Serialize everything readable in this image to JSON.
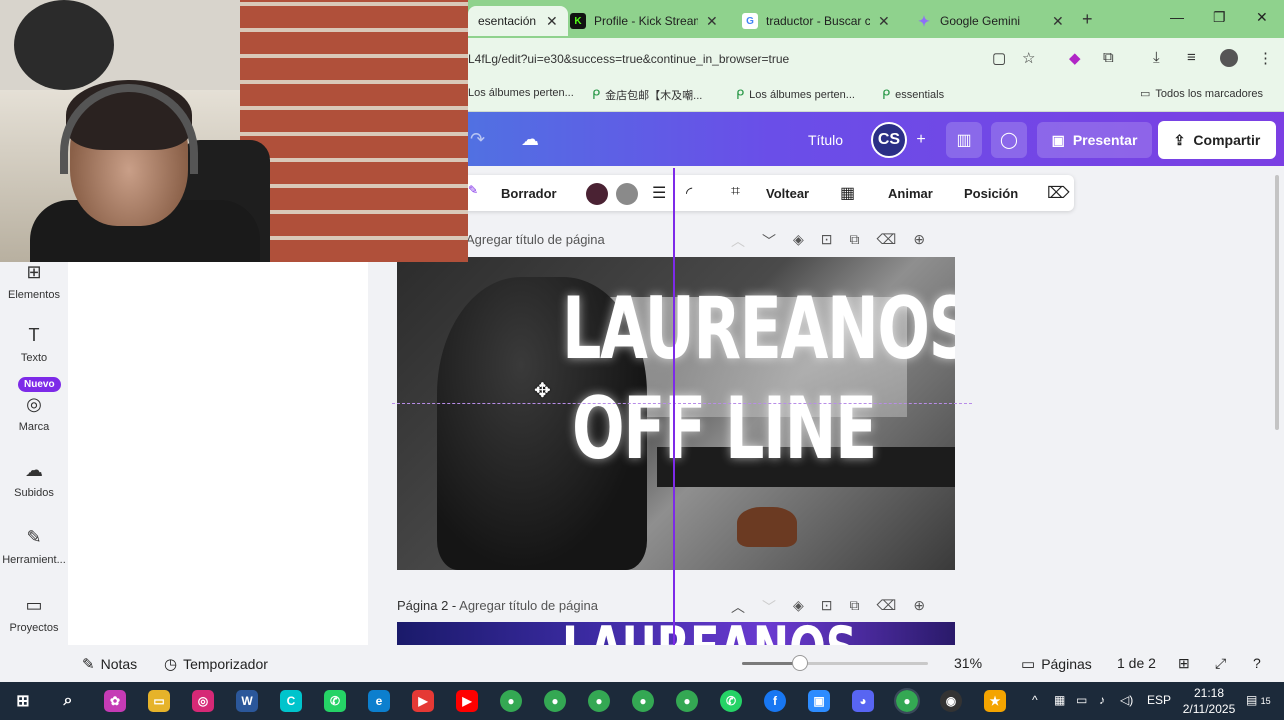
{
  "browser": {
    "tabs": [
      {
        "title": "esentación",
        "favicon": "canva-icon",
        "color": "#7d2ae8",
        "active": true
      },
      {
        "title": "Profile - Kick Streamin",
        "favicon": "kick-icon",
        "color": "#53fc18"
      },
      {
        "title": "traductor - Buscar co",
        "favicon": "google-icon",
        "color": "#4285f4"
      },
      {
        "title": "Google Gemini",
        "favicon": "gemini-icon",
        "color": "#8e6ff7"
      }
    ],
    "url": "L4fLg/edit?ui=e30&success=true&continue_in_browser=true",
    "bookmarks": [
      "Los álbumes perten...",
      "金店包邮【木及嘲...",
      "Los álbumes perten...",
      "essentials"
    ],
    "all_bookmarks": "Todos los marcadores"
  },
  "header": {
    "title": "Título",
    "avatar": "CS",
    "present": "Presentar",
    "share": "Compartir"
  },
  "toolbar": {
    "eraser": "Borrador",
    "flip": "Voltear",
    "animate": "Animar",
    "position": "Posición",
    "colors": [
      "#4a2233",
      "#8a8a8a"
    ]
  },
  "sidebar": {
    "items": [
      {
        "label": "Elementos",
        "icon": "shapes-icon"
      },
      {
        "label": "Texto",
        "icon": "text-icon"
      },
      {
        "label": "Marca",
        "icon": "brand-icon"
      },
      {
        "label": "Subidos",
        "icon": "upload-icon"
      },
      {
        "label": "Herramient...",
        "icon": "tools-icon"
      },
      {
        "label": "Proyectos",
        "icon": "folder-icon"
      }
    ],
    "new_badge": "Nuevo"
  },
  "pages": {
    "page1_title": "Agregar título de página",
    "page2_prefix": "Página 2 - ",
    "page2_title": "Agregar título de página",
    "slide_line1": "LAUREANOS",
    "slide_line2": "OFF LINE",
    "slide2_text": "LAUREANOS"
  },
  "footer": {
    "notes": "Notas",
    "timer": "Temporizador",
    "zoom": "31%",
    "zoom_level": 0.31,
    "pages": "Páginas",
    "page_count": "1 de 2"
  },
  "taskbar": {
    "lang": "ESP",
    "time": "21:18",
    "date": "2/11/2025",
    "notifications": "15"
  }
}
